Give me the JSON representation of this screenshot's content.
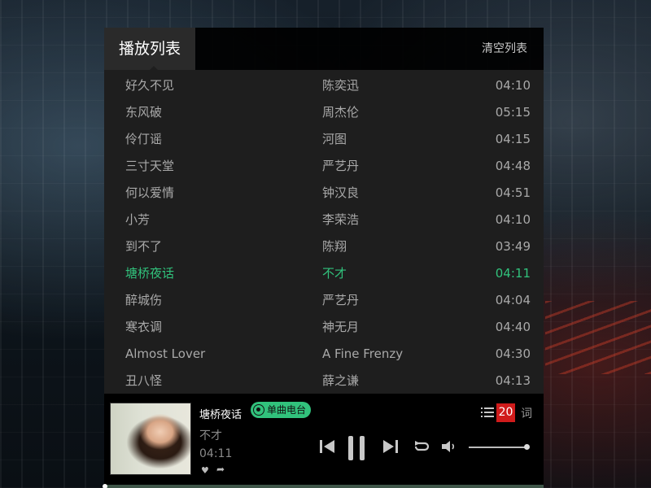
{
  "playlist": {
    "title": "播放列表",
    "clear_label": "清空列表",
    "active_index": 7,
    "songs": [
      {
        "title": "好久不见",
        "artist": "陈奕迅",
        "duration": "04:10"
      },
      {
        "title": "东风破",
        "artist": "周杰伦",
        "duration": "05:15"
      },
      {
        "title": "伶仃谣",
        "artist": "河图",
        "duration": "04:15"
      },
      {
        "title": "三寸天堂",
        "artist": "严艺丹",
        "duration": "04:48"
      },
      {
        "title": "何以爱情",
        "artist": "钟汉良",
        "duration": "04:51"
      },
      {
        "title": "小芳",
        "artist": "李荣浩",
        "duration": "04:10"
      },
      {
        "title": "到不了",
        "artist": "陈翔",
        "duration": "03:49"
      },
      {
        "title": "塘桥夜话",
        "artist": "不才",
        "duration": "04:11"
      },
      {
        "title": "醉城伤",
        "artist": "严艺丹",
        "duration": "04:04"
      },
      {
        "title": "寒衣调",
        "artist": "神无月",
        "duration": "04:40"
      },
      {
        "title": "Almost Lover",
        "artist": "A Fine Frenzy",
        "duration": "04:30"
      },
      {
        "title": "丑八怪",
        "artist": "薛之谦",
        "duration": "04:13"
      }
    ]
  },
  "player": {
    "song_title": "塘桥夜话",
    "artist": "不才",
    "time": "04:11",
    "radio_label": "单曲电台",
    "playlist_count": "20",
    "lyric_label": "词",
    "volume": 0.95,
    "progress": 0.0
  },
  "colors": {
    "accent": "#31c27c",
    "badge": "#d01b1b",
    "list_bg": "#1e1e1e"
  },
  "icons": {
    "like": "heart-icon",
    "share": "share-icon",
    "prev": "previous-icon",
    "pause": "pause-icon",
    "next": "next-icon",
    "loop": "loop-icon",
    "volume": "volume-icon",
    "playlist": "list-icon",
    "radio": "radio-icon"
  }
}
